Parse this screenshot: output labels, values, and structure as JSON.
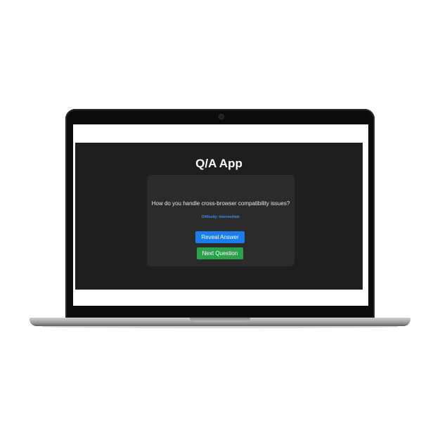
{
  "app": {
    "title": "Q/A App"
  },
  "card": {
    "question": "How do you handle cross-browser compatibility issues?",
    "difficulty": "Difficulty: Intermediate"
  },
  "buttons": {
    "reveal_label": "Reveal Answer",
    "next_label": "Next Question"
  },
  "colors": {
    "app_background": "#1e1e1e",
    "card_background": "#2b2b2b",
    "reveal_button": "#1a7de9",
    "next_button": "#2aa14a",
    "difficulty_text": "#3a8eea"
  }
}
